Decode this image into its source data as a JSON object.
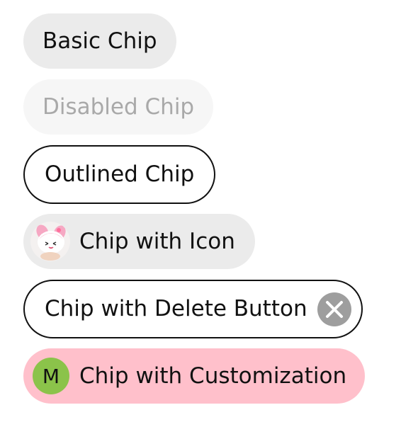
{
  "chips": {
    "basic": {
      "label": "Basic Chip"
    },
    "disabled": {
      "label": "Disabled Chip"
    },
    "outlined": {
      "label": "Outlined Chip"
    },
    "with_icon": {
      "label": "Chip with Icon",
      "icon": "character-avatar-icon"
    },
    "with_delete": {
      "label": "Chip with Delete Button",
      "icon": "close-icon"
    },
    "customized": {
      "label": "Chip with Customization",
      "avatar_letter": "M"
    }
  },
  "colors": {
    "chip_fill": "#ebebeb",
    "disabled_fill": "#f6f6f6",
    "disabled_text": "#a9a9a9",
    "outline": "#111111",
    "delete_icon_fill": "#9e9e9e",
    "custom_fill": "#ffc0cb",
    "avatar_fill": "#8bc34a"
  }
}
